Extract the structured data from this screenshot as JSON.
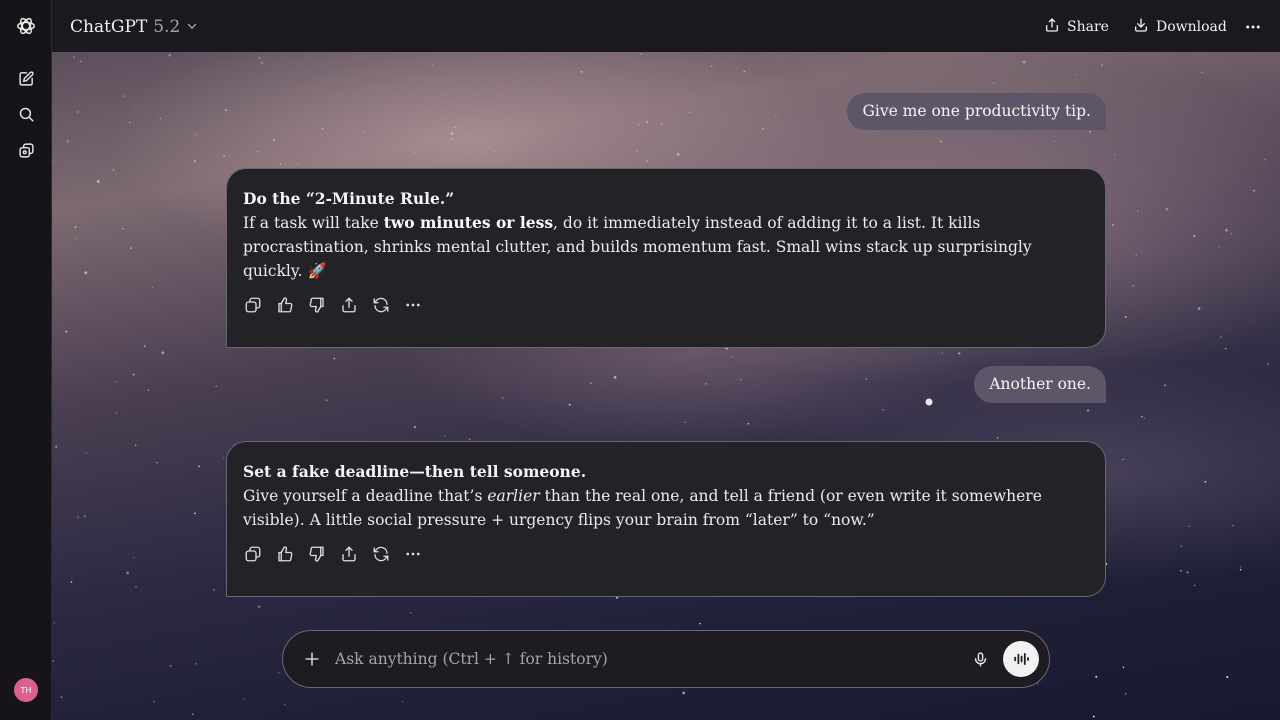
{
  "app": {
    "model_name": "ChatGPT",
    "model_version": "5.2"
  },
  "header": {
    "share_label": "Share",
    "download_label": "Download"
  },
  "sidebar": {
    "avatar_initials": "TH",
    "icons": [
      "openai-logo-icon",
      "new-chat-icon",
      "search-icon",
      "library-icon"
    ]
  },
  "messages": [
    {
      "role": "user",
      "text": "Give me one productivity tip."
    },
    {
      "role": "assistant",
      "title": "Do the “2-Minute Rule.”",
      "parts": [
        {
          "t": "If a task will take ",
          "style": "normal"
        },
        {
          "t": "two minutes or less",
          "style": "bold"
        },
        {
          "t": ", do it immediately instead of adding it to a list. It kills procrastination, shrinks mental clutter, and builds momentum fast. Small wins stack up surprisingly quickly. ",
          "style": "normal"
        },
        {
          "t": "🚀",
          "style": "normal"
        }
      ]
    },
    {
      "role": "user",
      "text": "Another one."
    },
    {
      "role": "assistant",
      "title": "Set a fake deadline—then tell someone.",
      "parts": [
        {
          "t": "Give yourself a deadline that’s ",
          "style": "normal"
        },
        {
          "t": "earlier",
          "style": "italic"
        },
        {
          "t": " than the real one, and tell a friend (or even write it somewhere visible). A little social pressure + urgency flips your brain from “later” to “now.”",
          "style": "normal"
        }
      ]
    }
  ],
  "message_actions": [
    "copy-icon",
    "thumbs-up-icon",
    "thumbs-down-icon",
    "share-icon",
    "regenerate-icon",
    "more-icon"
  ],
  "composer": {
    "placeholder": "Ask anything (Ctrl + ↑ for history)",
    "value": ""
  },
  "colors": {
    "user_bubble": "#5d5668",
    "assistant_card": "#232227",
    "sidebar": "#171419",
    "avatar": "#d9608f"
  }
}
